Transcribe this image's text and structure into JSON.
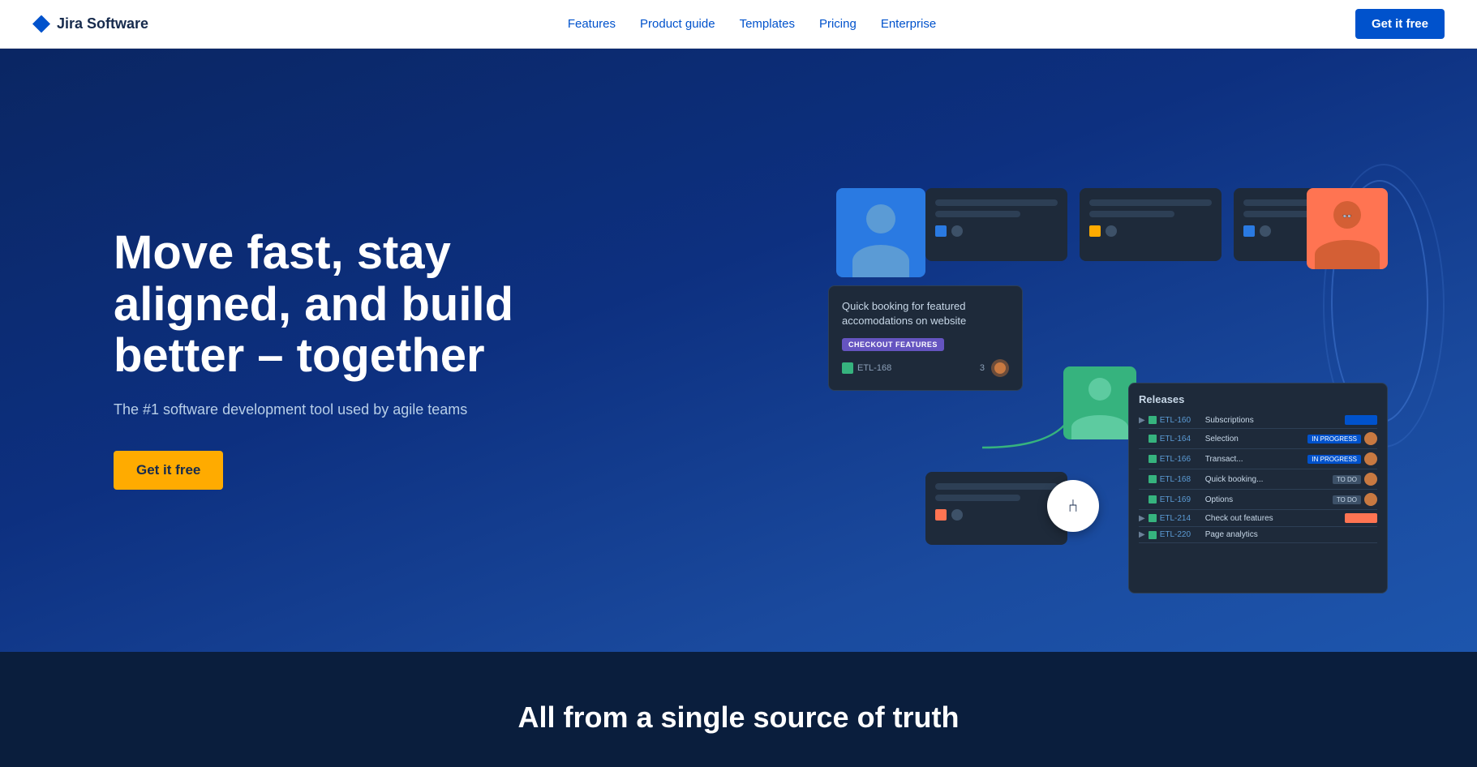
{
  "nav": {
    "logo_text": "Jira Software",
    "links": [
      {
        "label": "Features",
        "id": "features"
      },
      {
        "label": "Product guide",
        "id": "product-guide"
      },
      {
        "label": "Templates",
        "id": "templates"
      },
      {
        "label": "Pricing",
        "id": "pricing"
      },
      {
        "label": "Enterprise",
        "id": "enterprise"
      }
    ],
    "cta_label": "Get it free"
  },
  "hero": {
    "title": "Move fast, stay aligned, and build better – together",
    "subtitle": "The #1 software development tool used by agile teams",
    "cta_label": "Get it free"
  },
  "releases_panel": {
    "title": "Releases",
    "rows": [
      {
        "id": "ETL-160",
        "name": "Subscriptions",
        "badge": "",
        "expand": true
      },
      {
        "id": "ETL-164",
        "name": "Selection",
        "badge": "IN PROGRESS"
      },
      {
        "id": "ETL-166",
        "name": "Transact...",
        "badge": "IN PROGRESS"
      },
      {
        "id": "ETL-168",
        "name": "Quick booking...",
        "badge": "TO DO"
      },
      {
        "id": "ETL-169",
        "name": "Options",
        "badge": "TO DO"
      },
      {
        "id": "ETL-214",
        "name": "Check out features",
        "badge": ""
      },
      {
        "id": "ETL-220",
        "name": "Page analytics",
        "badge": ""
      }
    ]
  },
  "issue_card": {
    "title": "Quick booking for featured accomodations on website",
    "badge": "CHECKOUT FEATURES",
    "id": "ETL-168",
    "count": "3"
  },
  "bottom": {
    "title": "All from a single source of truth"
  }
}
